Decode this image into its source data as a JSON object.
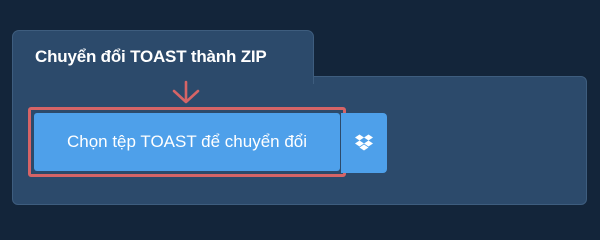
{
  "tab": {
    "title": "Chuyển đổi TOAST thành ZIP"
  },
  "actions": {
    "convert_label": "Chọn tệp TOAST để chuyển đổi",
    "dropbox_icon": "dropbox-icon",
    "pointer_icon": "arrow-down-icon"
  },
  "colors": {
    "background": "#13253a",
    "panel": "#2c4a6b",
    "button": "#4ea0ea",
    "highlight": "#d66466"
  }
}
